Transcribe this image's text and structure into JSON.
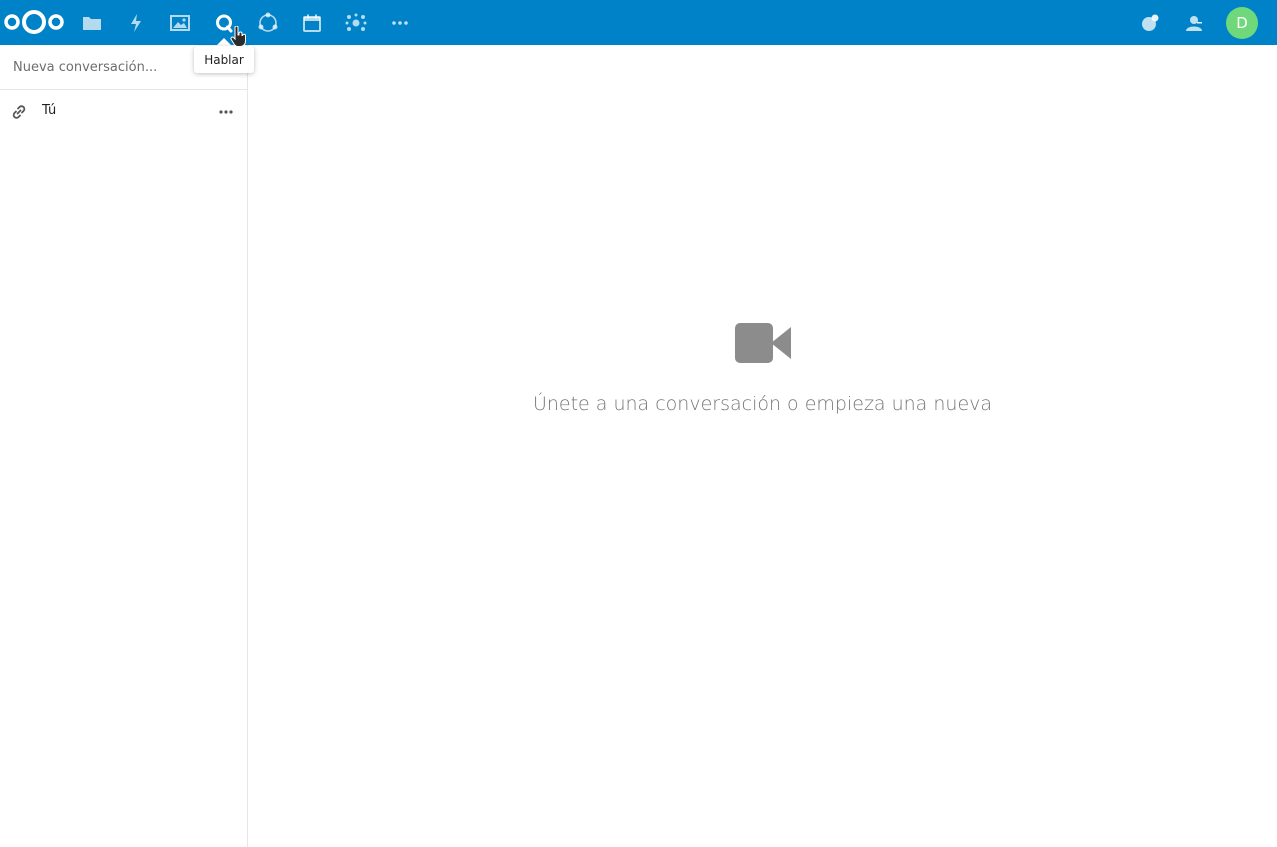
{
  "header": {
    "logo": "nextcloud-logo",
    "apps": [
      {
        "name": "files-icon"
      },
      {
        "name": "activity-icon"
      },
      {
        "name": "gallery-icon"
      },
      {
        "name": "talk-icon"
      },
      {
        "name": "circles-icon"
      },
      {
        "name": "calendar-icon"
      },
      {
        "name": "social-icon"
      },
      {
        "name": "more-apps-icon"
      }
    ],
    "right_icons": [
      {
        "name": "notifications-icon"
      },
      {
        "name": "contacts-icon"
      }
    ],
    "avatar_initial": "D",
    "accent_color": "#0082c9"
  },
  "tooltip": {
    "text": "Hablar"
  },
  "sidebar": {
    "search_placeholder": "Nueva conversación...",
    "conversations": [
      {
        "label": "Tú",
        "icon": "link-icon"
      }
    ]
  },
  "main": {
    "empty_icon": "video-camera-icon",
    "empty_text": "Únete a una conversación o empieza una nueva"
  }
}
